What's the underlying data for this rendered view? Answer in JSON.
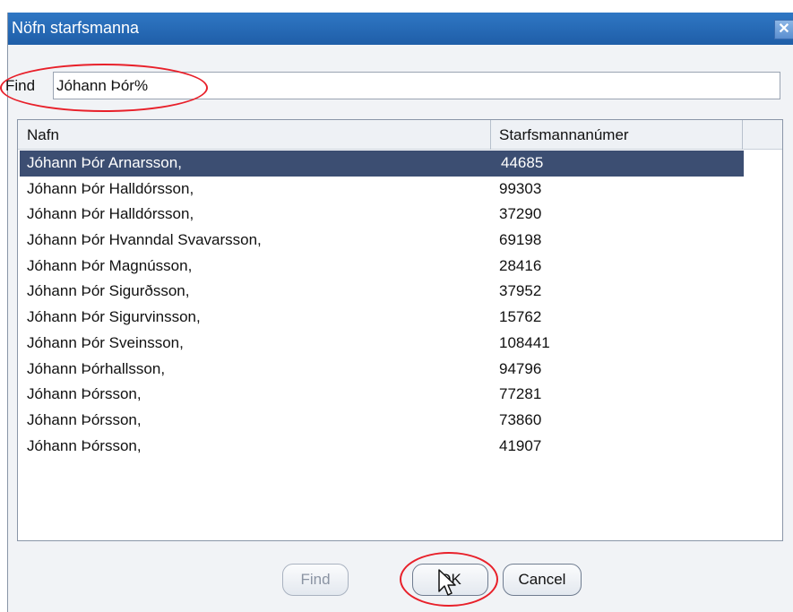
{
  "window": {
    "title": "Nöfn starfsmanna",
    "close_glyph": "✕"
  },
  "find": {
    "label": "Find",
    "value": "Jóhann Þór%"
  },
  "list": {
    "columns": [
      "Nafn",
      "Starfsmannanúmer"
    ],
    "selected_index": 0,
    "rows": [
      {
        "name": "Jóhann Þór Arnarsson,",
        "number": "44685"
      },
      {
        "name": "Jóhann Þór Halldórsson,",
        "number": "99303"
      },
      {
        "name": "Jóhann Þór Halldórsson,",
        "number": "37290"
      },
      {
        "name": "Jóhann Þór Hvanndal Svavarsson,",
        "number": "69198"
      },
      {
        "name": "Jóhann Þór Magnússon,",
        "number": "28416"
      },
      {
        "name": "Jóhann Þór Sigurðsson,",
        "number": "37952"
      },
      {
        "name": "Jóhann Þór Sigurvinsson,",
        "number": "15762"
      },
      {
        "name": "Jóhann Þór Sveinsson,",
        "number": "108441"
      },
      {
        "name": "Jóhann Þórhallsson,",
        "number": "94796"
      },
      {
        "name": "Jóhann Þórsson,",
        "number": "77281"
      },
      {
        "name": "Jóhann Þórsson,",
        "number": "73860"
      },
      {
        "name": "Jóhann Þórsson,",
        "number": "41907"
      }
    ]
  },
  "buttons": {
    "find_label": "Find",
    "ok_label": "OK",
    "cancel_label": "Cancel"
  },
  "colors": {
    "titlebar": "#2f77c4",
    "selection": "#3c4e72",
    "annotation": "#e8202a"
  }
}
